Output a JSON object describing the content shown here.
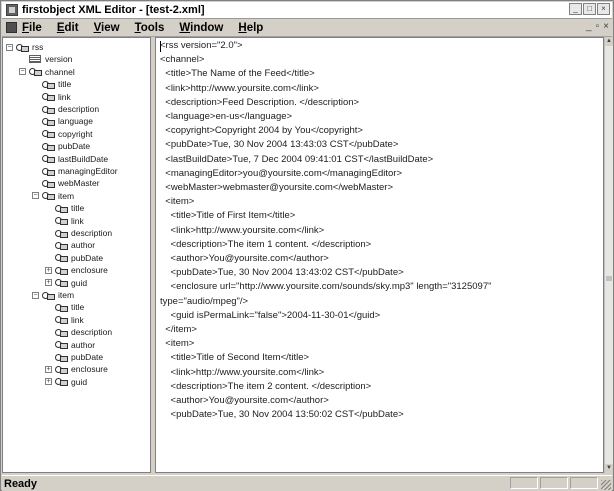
{
  "window": {
    "title": "firstobject XML Editor - [test-2.xml]"
  },
  "menubar": {
    "items": [
      {
        "label": "File",
        "key": "F"
      },
      {
        "label": "Edit",
        "key": "E"
      },
      {
        "label": "View",
        "key": "V"
      },
      {
        "label": "Tools",
        "key": "T"
      },
      {
        "label": "Window",
        "key": "W"
      },
      {
        "label": "Help",
        "key": "H"
      }
    ]
  },
  "tree": {
    "nodes": [
      {
        "label": "rss",
        "depth": 0,
        "expander": "−",
        "icon": "element"
      },
      {
        "label": "version",
        "depth": 1,
        "expander": "",
        "icon": "attribute"
      },
      {
        "label": "channel",
        "depth": 1,
        "expander": "−",
        "icon": "element"
      },
      {
        "label": "title",
        "depth": 2,
        "expander": "",
        "icon": "element"
      },
      {
        "label": "link",
        "depth": 2,
        "expander": "",
        "icon": "element"
      },
      {
        "label": "description",
        "depth": 2,
        "expander": "",
        "icon": "element"
      },
      {
        "label": "language",
        "depth": 2,
        "expander": "",
        "icon": "element"
      },
      {
        "label": "copyright",
        "depth": 2,
        "expander": "",
        "icon": "element"
      },
      {
        "label": "pubDate",
        "depth": 2,
        "expander": "",
        "icon": "element"
      },
      {
        "label": "lastBuildDate",
        "depth": 2,
        "expander": "",
        "icon": "element"
      },
      {
        "label": "managingEditor",
        "depth": 2,
        "expander": "",
        "icon": "element"
      },
      {
        "label": "webMaster",
        "depth": 2,
        "expander": "",
        "icon": "element"
      },
      {
        "label": "item",
        "depth": 2,
        "expander": "−",
        "icon": "element"
      },
      {
        "label": "title",
        "depth": 3,
        "expander": "",
        "icon": "element"
      },
      {
        "label": "link",
        "depth": 3,
        "expander": "",
        "icon": "element"
      },
      {
        "label": "description",
        "depth": 3,
        "expander": "",
        "icon": "element"
      },
      {
        "label": "author",
        "depth": 3,
        "expander": "",
        "icon": "element"
      },
      {
        "label": "pubDate",
        "depth": 3,
        "expander": "",
        "icon": "element"
      },
      {
        "label": "enclosure",
        "depth": 3,
        "expander": "+",
        "icon": "element"
      },
      {
        "label": "guid",
        "depth": 3,
        "expander": "+",
        "icon": "element"
      },
      {
        "label": "item",
        "depth": 2,
        "expander": "−",
        "icon": "element"
      },
      {
        "label": "title",
        "depth": 3,
        "expander": "",
        "icon": "element"
      },
      {
        "label": "link",
        "depth": 3,
        "expander": "",
        "icon": "element"
      },
      {
        "label": "description",
        "depth": 3,
        "expander": "",
        "icon": "element"
      },
      {
        "label": "author",
        "depth": 3,
        "expander": "",
        "icon": "element"
      },
      {
        "label": "pubDate",
        "depth": 3,
        "expander": "",
        "icon": "element"
      },
      {
        "label": "enclosure",
        "depth": 3,
        "expander": "+",
        "icon": "element"
      },
      {
        "label": "guid",
        "depth": 3,
        "expander": "+",
        "icon": "element"
      }
    ]
  },
  "editor": {
    "lines": [
      "<rss version=\"2.0\">",
      "<channel>",
      "  <title>The Name of the Feed</title>",
      "  <link>http://www.yoursite.com</link>",
      "  <description>Feed Description. </description>",
      "  <language>en-us</language>",
      "  <copyright>Copyright 2004 by You</copyright>",
      "  <pubDate>Tue, 30 Nov 2004 13:43:03 CST</pubDate>",
      "  <lastBuildDate>Tue, 7 Dec 2004 09:41:01 CST</lastBuildDate>",
      "  <managingEditor>you@yoursite.com</managingEditor>",
      "  <webMaster>webmaster@yoursite.com</webMaster>",
      "  <item>",
      "    <title>Title of First Item</title>",
      "    <link>http://www.yoursite.com</link>",
      "    <description>The item 1 content. </description>",
      "    <author>You@yoursite.com</author>",
      "    <pubDate>Tue, 30 Nov 2004 13:43:02 CST</pubDate>",
      "    <enclosure url=\"http://www.yoursite.com/sounds/sky.mp3\" length=\"3125097\"",
      "type=\"audio/mpeg\"/>",
      "    <guid isPermaLink=\"false\">2004-11-30-01</guid>",
      "  </item>",
      "  <item>",
      "    <title>Title of Second Item</title>",
      "    <link>http://www.yoursite.com</link>",
      "    <description>The item 2 content. </description>",
      "    <author>You@yoursite.com</author>",
      "    <pubDate>Tue, 30 Nov 2004 13:50:02 CST</pubDate>"
    ]
  },
  "statusbar": {
    "text": "Ready"
  }
}
